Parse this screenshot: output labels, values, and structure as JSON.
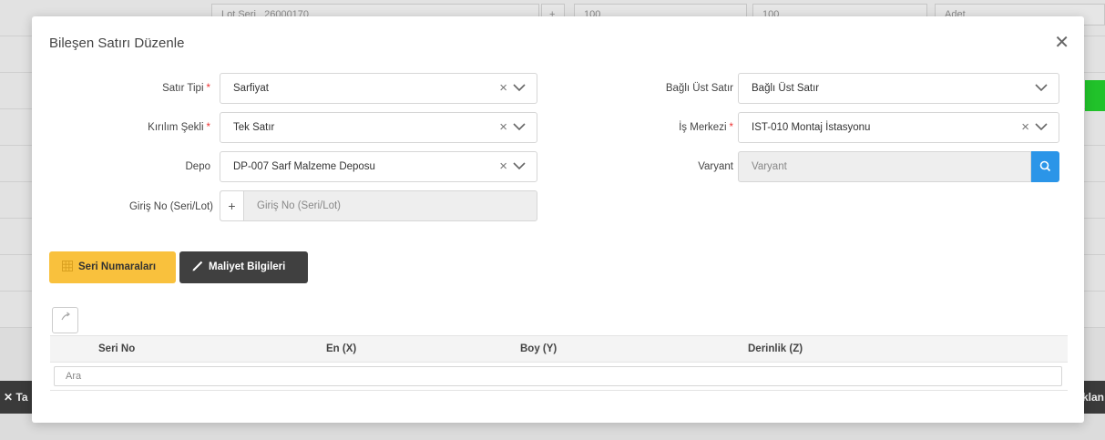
{
  "background": {
    "row1": [
      "Lot Seri",
      "26000170",
      "+",
      "100",
      "100",
      "Adet"
    ],
    "left_dark_label": "Ta",
    "right_dark_label": "klan"
  },
  "modal": {
    "title": "Bileşen Satırı Düzenle",
    "close_glyph": "✕"
  },
  "form": {
    "satir_tipi": {
      "label": "Satır Tipi",
      "required": "*",
      "value": "Sarfiyat"
    },
    "kirilim_sekli": {
      "label": "Kırılım Şekli",
      "required": "*",
      "value": "Tek Satır"
    },
    "depo": {
      "label": "Depo",
      "value": "DP-007 Sarf Malzeme Deposu"
    },
    "giris_no": {
      "label": "Giriş No (Seri/Lot)",
      "plus": "+",
      "placeholder": "Giriş No (Seri/Lot)"
    },
    "bagli_ust_satir": {
      "label": "Bağlı Üst Satır",
      "placeholder": "Bağlı Üst Satır"
    },
    "is_merkezi": {
      "label": "İş Merkezi",
      "required": "*",
      "value": "IST-010 Montaj İstasyonu"
    },
    "varyant": {
      "label": "Varyant",
      "placeholder": "Varyant"
    },
    "clear_glyph": "×"
  },
  "buttons": {
    "seri_numaralari": "Seri Numaraları",
    "maliyet_bilgileri": "Maliyet Bilgileri"
  },
  "table": {
    "columns": [
      "Seri No",
      "En (X)",
      "Boy (Y)",
      "Derinlik (Z)"
    ],
    "filter_placeholder": "Ara"
  },
  "icons": {
    "close": "close-icon",
    "clear": "clear-icon",
    "chevron": "chevron-down-icon",
    "search": "search-icon",
    "grid": "grid-icon",
    "pencil": "pencil-icon",
    "export": "export-icon"
  },
  "colors": {
    "required": "#e33333",
    "search_button": "#2b95e8",
    "primary_yellow": "#f9c13d",
    "dark_button": "#404040"
  }
}
